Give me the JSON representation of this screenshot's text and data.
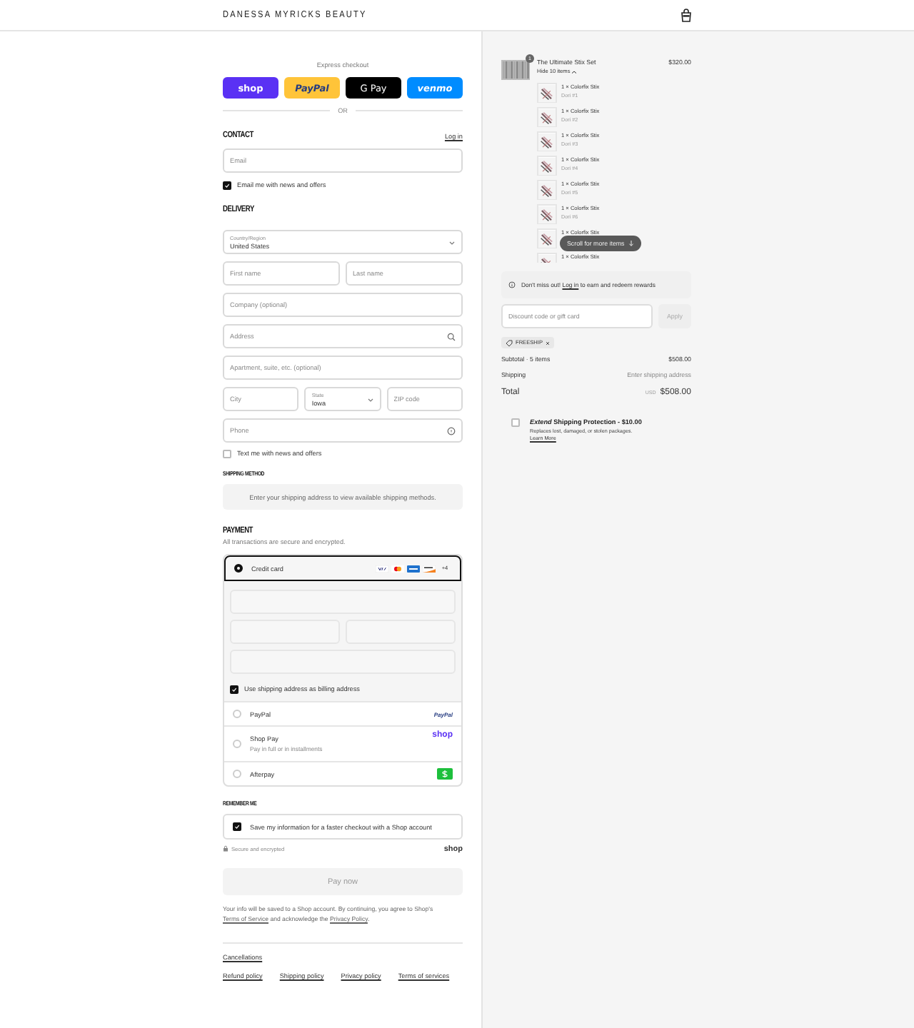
{
  "header": {
    "brand": "DANESSA MYRICKS BEAUTY"
  },
  "express": {
    "title": "Express checkout",
    "buttons": [
      {
        "kind": "shop",
        "label": "shop"
      },
      {
        "kind": "paypal",
        "label": "PayPal"
      },
      {
        "kind": "gpay",
        "label": "G Pay"
      },
      {
        "kind": "venmo",
        "label": "venmo"
      }
    ],
    "divider": "OR"
  },
  "contact": {
    "heading": "CONTACT",
    "login": "Log in",
    "email": {
      "placeholder": "Email"
    },
    "news": {
      "label": "Email me with news and offers",
      "checked": true
    }
  },
  "delivery": {
    "heading": "DELIVERY",
    "rows": [
      [
        {
          "kind": "select",
          "label": "Country/Region",
          "value": "United States"
        }
      ],
      [
        {
          "kind": "text",
          "placeholder": "First name"
        },
        {
          "kind": "text",
          "placeholder": "Last name"
        }
      ],
      [
        {
          "kind": "text",
          "placeholder": "Company (optional)"
        }
      ],
      [
        {
          "kind": "search",
          "placeholder": "Address"
        }
      ],
      [
        {
          "kind": "text",
          "placeholder": "Apartment, suite, etc. (optional)"
        }
      ],
      [
        {
          "kind": "text",
          "placeholder": "City"
        },
        {
          "kind": "select",
          "label": "State",
          "value": "Iowa"
        },
        {
          "kind": "text",
          "placeholder": "ZIP code"
        }
      ],
      [
        {
          "kind": "help",
          "placeholder": "Phone"
        }
      ]
    ],
    "sms": {
      "label": "Text me with news and offers",
      "checked": false
    }
  },
  "shipping_method": {
    "heading": "SHIPPING METHOD",
    "note": "Enter your shipping address to view available shipping methods."
  },
  "payment": {
    "heading": "PAYMENT",
    "subtitle": "All transactions are secure and encrypted.",
    "methods": [
      {
        "kind": "card",
        "label": "Credit card",
        "selected": true,
        "more": "+4",
        "billing": {
          "label": "Use shipping address as billing address",
          "checked": true
        }
      },
      {
        "kind": "paypal",
        "label": "PayPal",
        "logo": "PayPal",
        "selected": false
      },
      {
        "kind": "shoppay",
        "label": "Shop Pay",
        "note": "Pay in full or in installments",
        "logo": "shop",
        "selected": false
      },
      {
        "kind": "afterpay",
        "label": "Afterpay",
        "selected": false
      }
    ]
  },
  "remember": {
    "heading": "REMEMBER ME",
    "save": {
      "label": "Save my information for a faster checkout with a Shop account",
      "checked": true
    },
    "secure": "Secure and encrypted",
    "logo": "shop"
  },
  "pay_button": "Pay now",
  "legal": {
    "before": "Your info will be saved to a Shop account. By continuing, you agree to Shop's",
    "terms": "Terms of Service",
    "middle": "and acknowledge the",
    "privacy": "Privacy Policy",
    "after": "."
  },
  "footer": {
    "top_links": [
      "Cancellations"
    ],
    "links": [
      "Refund policy",
      "Shipping policy",
      "Privacy policy",
      "Terms of services"
    ]
  },
  "summary": {
    "product": {
      "quantity": "1",
      "name": "The Ultimate Stix Set",
      "price": "$320.00",
      "toggle": "Hide 10 items",
      "items": [
        {
          "name": "1 × Colorfix Stix",
          "variant": "Dori #1"
        },
        {
          "name": "1 × Colorfix Stix",
          "variant": "Dori #2"
        },
        {
          "name": "1 × Colorfix Stix",
          "variant": "Dori #3"
        },
        {
          "name": "1 × Colorfix Stix",
          "variant": "Dori #4"
        },
        {
          "name": "1 × Colorfix Stix",
          "variant": "Dori #5"
        },
        {
          "name": "1 × Colorfix Stix",
          "variant": "Dori #6"
        },
        {
          "name": "1 × Colorfix Stix"
        },
        {
          "name": "1 × Colorfix Stix"
        }
      ],
      "scroll_hint": "Scroll for more items"
    },
    "rewards": {
      "before": "Don't miss out!",
      "link": "Log in",
      "after": "to earn and redeem rewards"
    },
    "discount": {
      "placeholder": "Discount code or gift card",
      "button": "Apply",
      "code": "FREESHIP"
    },
    "totals": [
      {
        "label": "Subtotal · 5 items",
        "value": "$508.00"
      },
      {
        "label": "Shipping",
        "value": "Enter shipping address"
      }
    ],
    "total": {
      "label": "Total",
      "currency": "USD",
      "value": "$508.00"
    },
    "extend": {
      "checked": false,
      "brand": "Extend",
      "title": "Shipping Protection - $10.00",
      "note": "Replaces lost, damaged, or stolen packages.",
      "link": "Learn More"
    }
  }
}
